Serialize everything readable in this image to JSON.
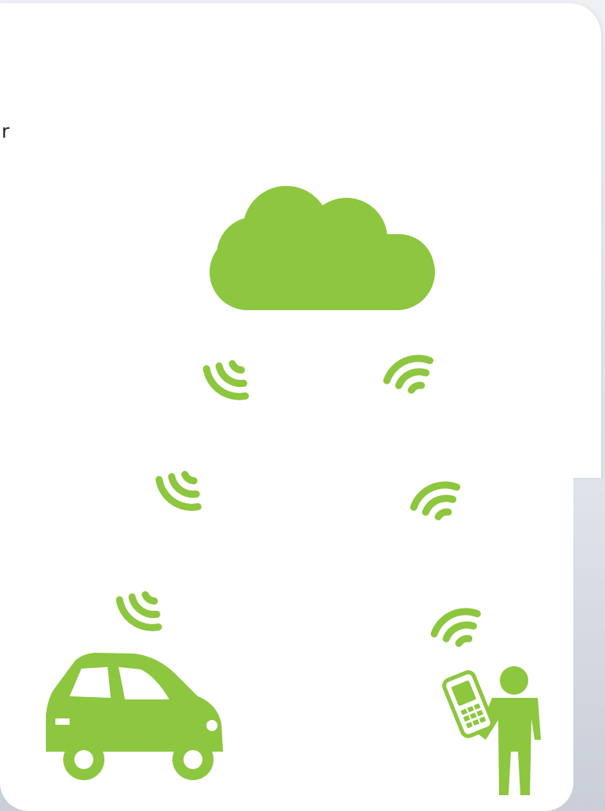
{
  "fragment_text": "r",
  "colors": {
    "accent_green": "#8dc63f",
    "card": "#ffffff"
  },
  "icons": [
    "cloud-icon",
    "signal-wave-icon",
    "car-icon",
    "person-with-phone-icon"
  ]
}
